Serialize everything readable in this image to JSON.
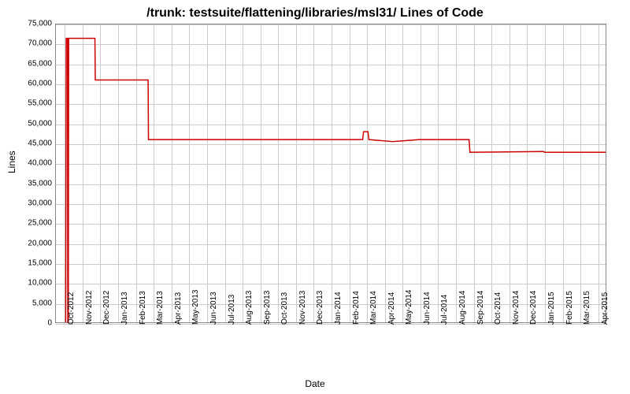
{
  "chart_data": {
    "type": "line",
    "title": "/trunk: testsuite/flattening/libraries/msl31/ Lines of Code",
    "xlabel": "Date",
    "ylabel": "Lines",
    "ylim": [
      0,
      75000
    ],
    "y_ticks": [
      0,
      5000,
      10000,
      15000,
      20000,
      25000,
      30000,
      35000,
      40000,
      45000,
      50000,
      55000,
      60000,
      65000,
      70000,
      75000
    ],
    "x_categories": [
      "Oct-2012",
      "Nov-2012",
      "Dec-2012",
      "Jan-2013",
      "Feb-2013",
      "Mar-2013",
      "Apr-2013",
      "May-2013",
      "Jun-2013",
      "Jul-2013",
      "Aug-2013",
      "Sep-2013",
      "Oct-2013",
      "Nov-2013",
      "Dec-2013",
      "Jan-2014",
      "Feb-2014",
      "Mar-2014",
      "Apr-2014",
      "May-2014",
      "Jun-2014",
      "Jul-2014",
      "Aug-2014",
      "Sep-2014",
      "Oct-2014",
      "Nov-2014",
      "Dec-2014",
      "Jan-2015",
      "Feb-2015",
      "Mar-2015",
      "Apr-2015"
    ],
    "series": [
      {
        "name": "Lines of Code",
        "color": "#cc0000",
        "points": [
          {
            "x": 0.05,
            "y": 0
          },
          {
            "x": 0.08,
            "y": 71500
          },
          {
            "x": 0.15,
            "y": 71500
          },
          {
            "x": 0.17,
            "y": 0
          },
          {
            "x": 0.2,
            "y": 0
          },
          {
            "x": 0.22,
            "y": 71500
          },
          {
            "x": 1.7,
            "y": 71500
          },
          {
            "x": 1.72,
            "y": 61000
          },
          {
            "x": 4.7,
            "y": 61000
          },
          {
            "x": 4.72,
            "y": 46000
          },
          {
            "x": 16.8,
            "y": 46000
          },
          {
            "x": 16.85,
            "y": 48000
          },
          {
            "x": 17.1,
            "y": 48000
          },
          {
            "x": 17.15,
            "y": 46000
          },
          {
            "x": 18.5,
            "y": 45500
          },
          {
            "x": 20.0,
            "y": 46000
          },
          {
            "x": 22.8,
            "y": 46000
          },
          {
            "x": 22.85,
            "y": 42800
          },
          {
            "x": 27.0,
            "y": 43000
          },
          {
            "x": 27.05,
            "y": 42800
          },
          {
            "x": 30.5,
            "y": 42800
          }
        ]
      }
    ]
  }
}
